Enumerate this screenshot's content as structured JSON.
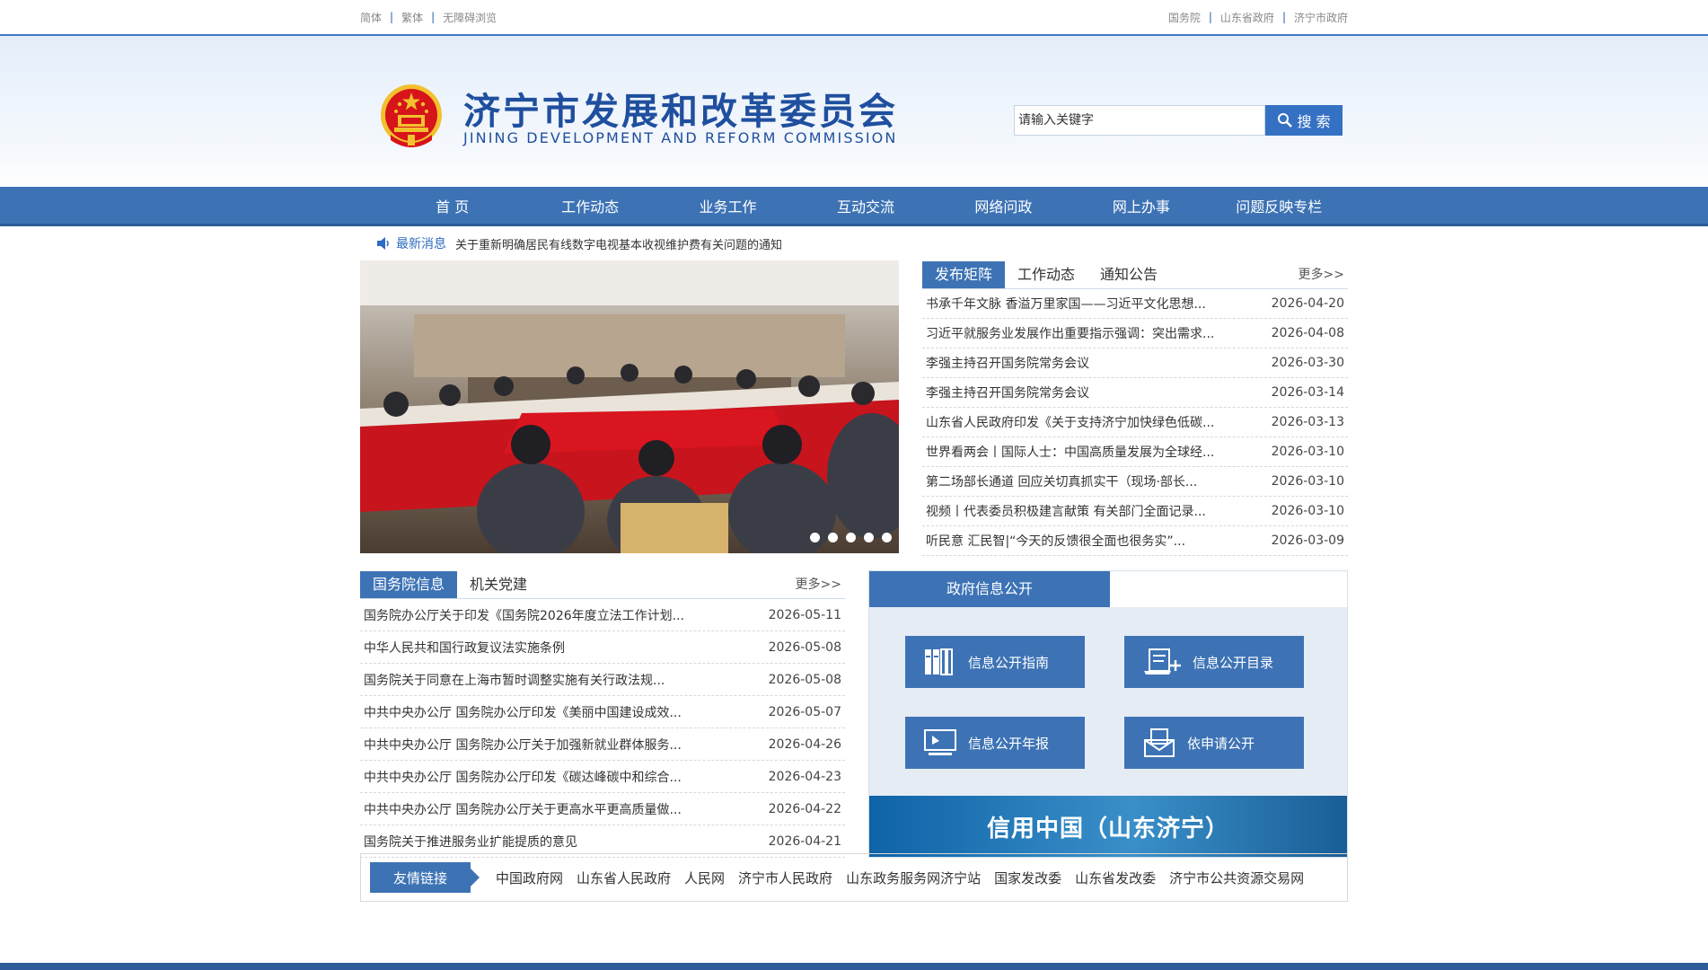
{
  "topbar": {
    "left_links": [
      "简体",
      "繁体",
      "无障碍浏览"
    ],
    "right_links": [
      "国务院",
      "山东省政府",
      "济宁市政府"
    ]
  },
  "header": {
    "title": "济宁市发展和改革委员会",
    "subtitle": "JINING DEVELOPMENT AND REFORM COMMISSION",
    "search_placeholder": "请输入关键字",
    "search_button": "搜 索"
  },
  "nav": {
    "items": [
      "首 页",
      "工作动态",
      "业务工作",
      "互动交流",
      "网络问政",
      "网上办事",
      "问题反映专栏"
    ]
  },
  "ticker": {
    "label": "最新消息",
    "text": "关于重新明确居民有线数字电视基本收视维护费有关问题的通知"
  },
  "news_panel": {
    "tabs": [
      "发布矩阵",
      "工作动态",
      "通知公告"
    ],
    "more": "更多>>",
    "items": [
      {
        "title": "书承千年文脉 香溢万里家国——习近平文化思想...",
        "date": "2026-04-20"
      },
      {
        "title": "习近平就服务业发展作出重要指示强调：突出需求...",
        "date": "2026-04-08"
      },
      {
        "title": "李强主持召开国务院常务会议",
        "date": "2026-03-30"
      },
      {
        "title": "李强主持召开国务院常务会议",
        "date": "2026-03-14"
      },
      {
        "title": "山东省人民政府印发《关于支持济宁加快绿色低碳...",
        "date": "2026-03-13"
      },
      {
        "title": "世界看两会丨国际人士：中国高质量发展为全球经...",
        "date": "2026-03-10"
      },
      {
        "title": "第二场部长通道 回应关切真抓实干（现场·部长...",
        "date": "2026-03-10"
      },
      {
        "title": "视频丨代表委员积极建言献策 有关部门全面记录...",
        "date": "2026-03-10"
      },
      {
        "title": "听民意 汇民智|“今天的反馈很全面也很务实”...",
        "date": "2026-03-09"
      }
    ]
  },
  "gw_panel": {
    "tabs": [
      "国务院信息",
      "机关党建"
    ],
    "more": "更多>>",
    "items": [
      {
        "title": "国务院办公厅关于印发《国务院2026年度立法工作计划...",
        "date": "2026-05-11"
      },
      {
        "title": "中华人民共和国行政复议法实施条例",
        "date": "2026-05-08"
      },
      {
        "title": "国务院关于同意在上海市暂时调整实施有关行政法规...",
        "date": "2026-05-08"
      },
      {
        "title": "中共中央办公厅 国务院办公厅印发《美丽中国建设成效...",
        "date": "2026-05-07"
      },
      {
        "title": "中共中央办公厅 国务院办公厅关于加强新就业群体服务...",
        "date": "2026-04-26"
      },
      {
        "title": "中共中央办公厅 国务院办公厅印发《碳达峰碳中和综合...",
        "date": "2026-04-23"
      },
      {
        "title": "中共中央办公厅 国务院办公厅关于更高水平更高质量做...",
        "date": "2026-04-22"
      },
      {
        "title": "国务院关于推进服务业扩能提质的意见",
        "date": "2026-04-21"
      }
    ]
  },
  "info_panel": {
    "title": "政府信息公开",
    "buttons": [
      "信息公开指南",
      "信息公开目录",
      "信息公开年报",
      "依申请公开"
    ],
    "credit_banner": "信用中国（山东济宁）"
  },
  "friends": {
    "label": "友情链接",
    "links": [
      "中国政府网",
      "山东省人民政府",
      "人民网",
      "济宁市人民政府",
      "山东政务服务网济宁站",
      "国家发改委",
      "山东省发改委",
      "济宁市公共资源交易网"
    ]
  },
  "colors": {
    "brand_blue": "#3d73b5",
    "title_blue": "#1f4f9e",
    "accent_red": "#d7141a"
  }
}
